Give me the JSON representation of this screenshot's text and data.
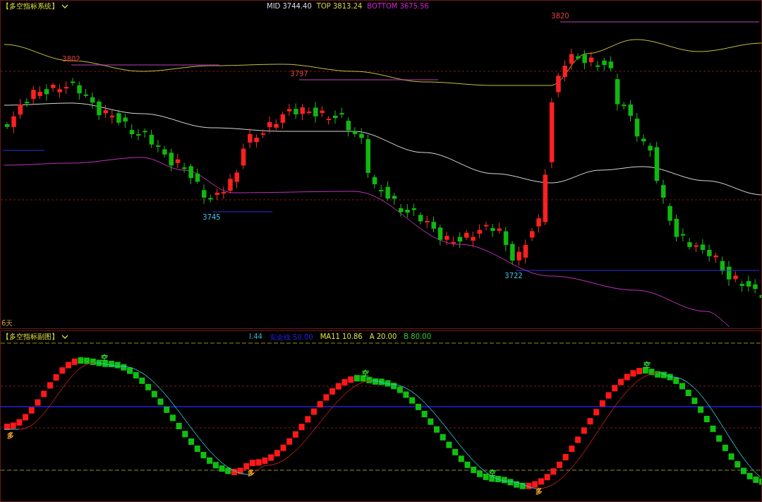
{
  "main": {
    "title": "【多空指标系统】",
    "legend": [
      {
        "label": "MID",
        "value": "3744.40",
        "kind": "mid"
      },
      {
        "label": "TOP",
        "value": "3813.24",
        "kind": "top"
      },
      {
        "label": "BOTTOM",
        "value": "3675.56",
        "kind": "bottom"
      }
    ],
    "price_labels": [
      {
        "text": "3802",
        "kind": "high"
      },
      {
        "text": "3797",
        "kind": "high"
      },
      {
        "text": "3745",
        "kind": "low"
      },
      {
        "text": "3722",
        "kind": "low"
      },
      {
        "text": "3820",
        "kind": "high"
      }
    ],
    "period": "6天"
  },
  "sub": {
    "title": "【多空指标副图】",
    "legend": [
      {
        "text": "I.44",
        "kind": "line"
      },
      {
        "text": "安全线 50.00",
        "kind": "safe"
      },
      {
        "text": "MA11 10.86",
        "kind": "ma"
      },
      {
        "text": "A 20.00",
        "kind": "a"
      },
      {
        "text": "B 80.00",
        "kind": "b"
      }
    ],
    "signals": [
      {
        "text": "多",
        "kind": "buy"
      },
      {
        "text": "空",
        "kind": "sell"
      },
      {
        "text": "多",
        "kind": "buy"
      },
      {
        "text": "空",
        "kind": "sell"
      },
      {
        "text": "空",
        "kind": "sell"
      },
      {
        "text": "多",
        "kind": "buy"
      },
      {
        "text": "空",
        "kind": "sell"
      }
    ]
  }
}
